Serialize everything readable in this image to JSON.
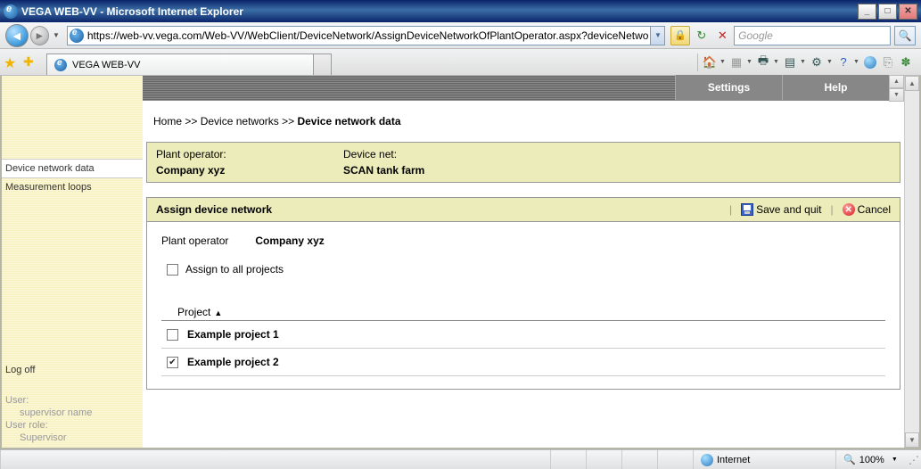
{
  "window": {
    "title": "VEGA WEB-VV - Microsoft Internet Explorer"
  },
  "nav": {
    "url": "https://web-vv.vega.com/Web-VV/WebClient/DeviceNetwork/AssignDeviceNetworkOfPlantOperator.aspx?deviceNetwo",
    "search_placeholder": "Google"
  },
  "tab": {
    "title": "VEGA WEB-VV"
  },
  "vega_nav": {
    "settings": "Settings",
    "help": "Help"
  },
  "sidebar": {
    "items": [
      {
        "label": "Device network data",
        "active": true
      },
      {
        "label": "Measurement loops",
        "active": false
      }
    ],
    "logoff": "Log off",
    "user_label": "User:",
    "user_value": "supervisor name",
    "role_label": "User role:",
    "role_value": "Supervisor"
  },
  "breadcrumb": {
    "home": "Home",
    "sep": ">>",
    "l1": "Device networks",
    "l2": "Device network data"
  },
  "infobox": {
    "po_label": "Plant operator:",
    "po_value": "Company xyz",
    "dn_label": "Device net:",
    "dn_value": "SCAN tank farm"
  },
  "panel": {
    "title": "Assign device network",
    "save": "Save and quit",
    "cancel": "Cancel",
    "po_label": "Plant operator",
    "po_value": "Company xyz",
    "assign_all": "Assign to all projects",
    "project_col": "Project",
    "projects": [
      {
        "name": "Example project 1",
        "checked": false
      },
      {
        "name": "Example project 2",
        "checked": true
      }
    ]
  },
  "statusbar": {
    "zone": "Internet",
    "zoom": "100%"
  }
}
